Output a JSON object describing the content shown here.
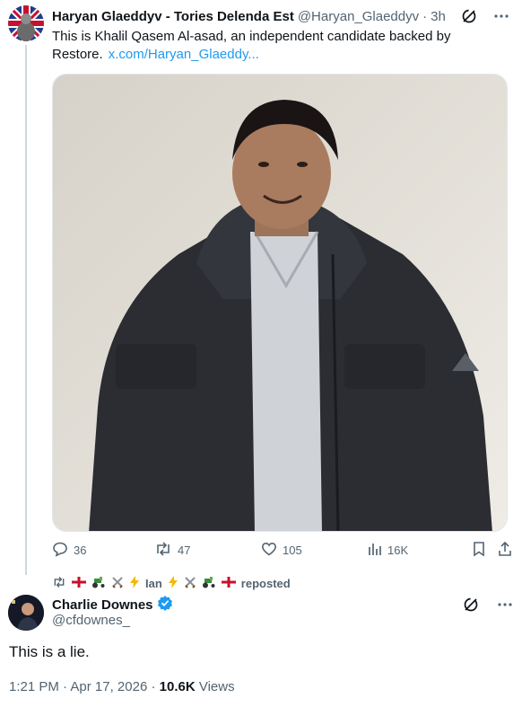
{
  "quoted": {
    "author_name": "Haryan Glaeddyv - Tories Delenda Est",
    "author_handle": "@Haryan_Glaeddyv",
    "separator": "·",
    "time": "3h",
    "text": "This is Khalil Qasem Al-asad, an independent candidate backed by Restore.",
    "link": "x.com/Haryan_Glaeddy...",
    "stats": {
      "replies": "36",
      "reposts": "47",
      "likes": "105",
      "views": "16K"
    }
  },
  "repost_banner": {
    "name": "Ian",
    "suffix": "reposted"
  },
  "main": {
    "author_name": "Charlie Downes",
    "author_handle": "@cfdownes_",
    "text": "This is a lie.",
    "time": "1:21 PM",
    "date": "Apr 17, 2026",
    "views_count": "10.6K",
    "views_label": "Views"
  },
  "icons": {
    "grok": "grok-icon",
    "more": "more-icon",
    "reply": "reply-icon",
    "repost": "repost-icon",
    "like": "like-icon",
    "views": "views-icon",
    "bookmark": "bookmark-icon",
    "share": "share-icon",
    "verified": "verified-badge-icon"
  },
  "colors": {
    "link": "#1d9bf0",
    "verified": "#1d9bf0",
    "muted": "#536471"
  }
}
